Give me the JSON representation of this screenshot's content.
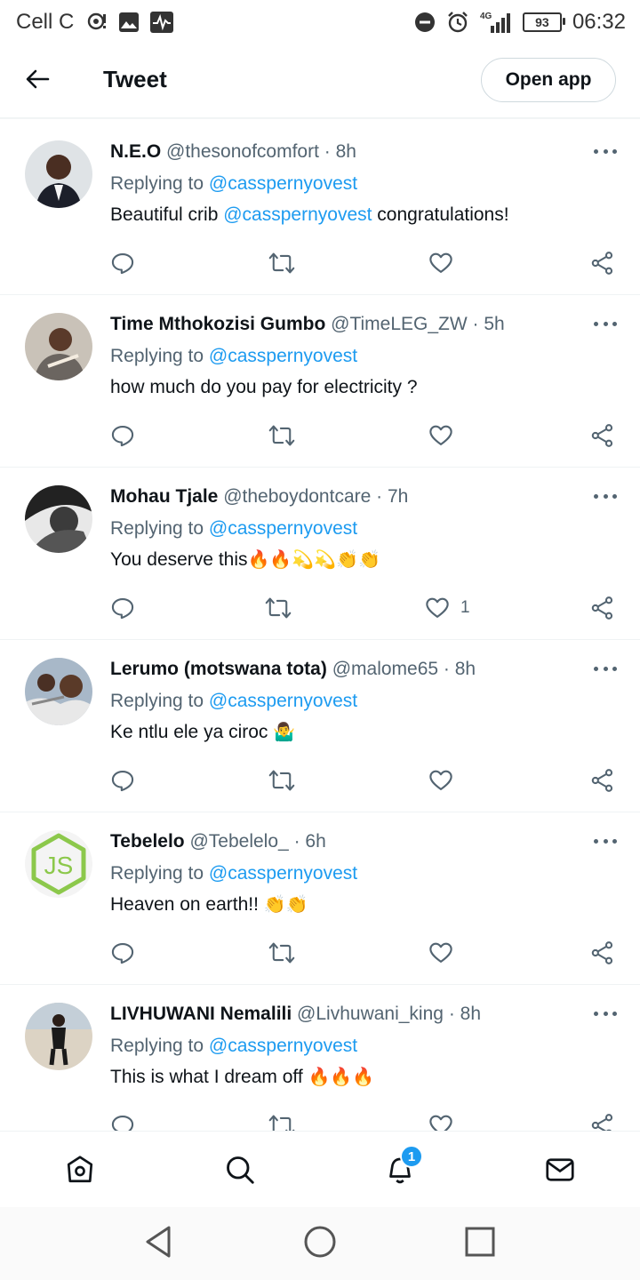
{
  "status_bar": {
    "carrier": "Cell C",
    "network": "4G",
    "battery": "93",
    "time": "06:32"
  },
  "header": {
    "title": "Tweet",
    "open_app": "Open app"
  },
  "replying_label": "Replying to",
  "reply_handle": "@casspernyovest",
  "tweets": [
    {
      "name": "N.E.O",
      "handle": "@thesonofcomfort",
      "time": "· 8h",
      "text": "Beautiful crib ",
      "text_mention": "@casspernyovest",
      "text_after": " congratulations!",
      "emoji": "",
      "likes": ""
    },
    {
      "name": "Time Mthokozisi Gumbo",
      "handle": "@TimeLEG_ZW",
      "time": "· 5h",
      "text": "how much do you pay for electricity ?",
      "text_mention": "",
      "text_after": "",
      "emoji": "",
      "likes": ""
    },
    {
      "name": "Mohau Tjale",
      "handle": "@theboydontcare",
      "time": "· 7h",
      "text": "You deserve this",
      "text_mention": "",
      "text_after": "",
      "emoji": "🔥🔥💫💫👏👏",
      "likes": "1"
    },
    {
      "name": "Lerumo (motswana tota)",
      "handle": "@malome65",
      "time": "· 8h",
      "text": "Ke ntlu ele ya ciroc ",
      "text_mention": "",
      "text_after": "",
      "emoji": "🤷‍♂️",
      "likes": ""
    },
    {
      "name": "Tebelelo",
      "handle": "@Tebelelo_",
      "time": "· 6h",
      "text": "Heaven on earth!! ",
      "text_mention": "",
      "text_after": "",
      "emoji": "👏👏",
      "likes": ""
    },
    {
      "name": "LIVHUWANI Nemalili",
      "handle": "@Livhuwani_king",
      "time": "· 8h",
      "text": "This is what I dream off ",
      "text_mention": "",
      "text_after": "",
      "emoji": "🔥🔥🔥",
      "likes": ""
    }
  ],
  "bottom_nav": {
    "notification_count": "1"
  },
  "colors": {
    "accent": "#1d9bf0",
    "text": "#0f1419",
    "secondary": "#536471"
  }
}
